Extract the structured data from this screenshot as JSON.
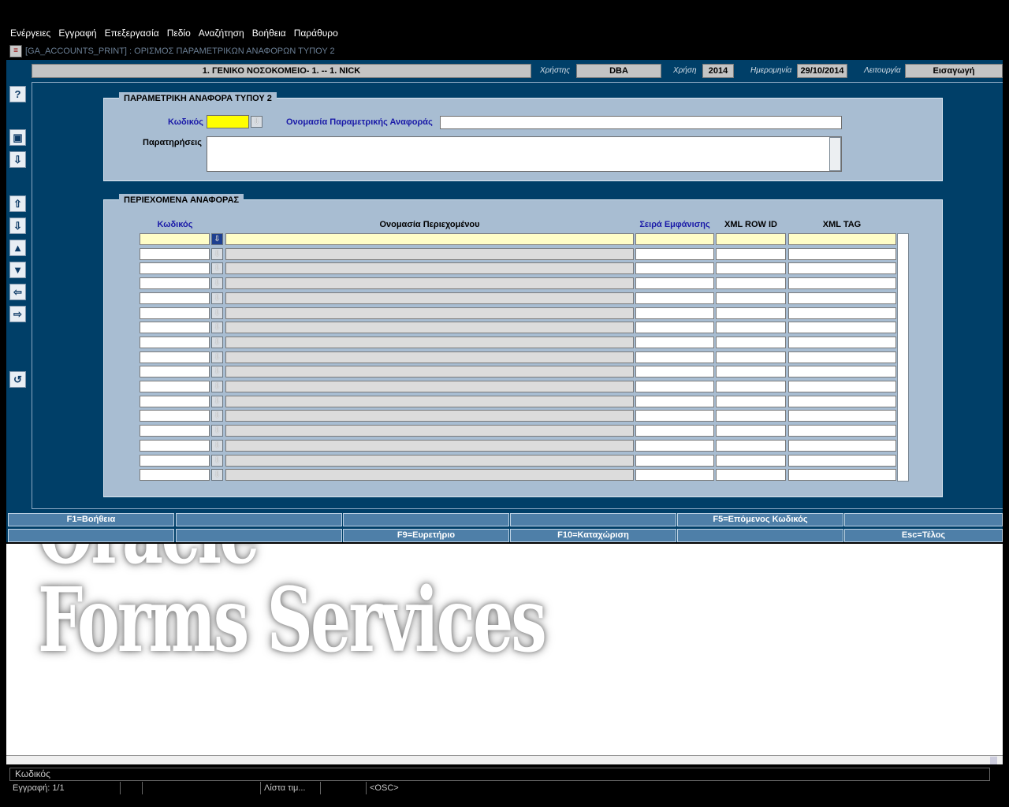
{
  "menu": [
    "Ενέργειες",
    "Εγγραφή",
    "Επεξεργασία",
    "Πεδίο",
    "Αναζήτηση",
    "Βοήθεια",
    "Παράθυρο"
  ],
  "window": {
    "title": "[GA_ACCOUNTS_PRINT]   :   ΟΡΙΣΜΟΣ ΠΑΡΑΜΕΤΡΙΚΩΝ ΑΝΑΦΟΡΩΝ ΤΥΠΟΥ 2"
  },
  "header": {
    "organization": "1. ΓΕΝΙΚΟ ΝΟΣΟΚΟΜΕΙΟ- 1. -- 1. NICK",
    "user_label": "Χρήστης",
    "user": "DBA",
    "year_label": "Χρήση",
    "year": "2014",
    "date_label": "Ημερομηνία",
    "date": "29/10/2014",
    "mode_label": "Λειτουργία",
    "mode": "Εισαγωγή"
  },
  "side_buttons": {
    "help": "?",
    "save": "▣",
    "download": "⇩",
    "first": "⇧",
    "last": "⇩",
    "prev": "▲",
    "next": "▼",
    "left": "⇦",
    "right": "⇨",
    "undo": "↺"
  },
  "report_block": {
    "title": "ΠΑΡΑΜΕΤΡΙΚΗ ΑΝΑΦΟΡΑ ΤΥΠΟΥ 2",
    "code_label": "Κωδικός",
    "code_value": "",
    "name_label": "Ονομασία Παραμετρικής Αναφοράς",
    "name_value": "",
    "notes_label": "Παρατηρήσεις",
    "notes_value": ""
  },
  "contents_block": {
    "title": "ΠΕΡΙΕΧΟΜΕΝΑ ΑΝΑΦΟΡΑΣ",
    "columns": {
      "code": "Κωδικός",
      "name": "Ονομασία Περιεχομένου",
      "order": "Σειρά Εμφάνισης",
      "rowid": "XML ROW ID",
      "tag": "XML TAG"
    },
    "row_count": 17
  },
  "function_keys": {
    "row1": [
      "F1=Βοήθεια",
      "",
      "",
      "",
      "F5=Επόμενος Κωδικός",
      ""
    ],
    "row2": [
      "",
      "",
      "F9=Ευρετήριο",
      "F10=Καταχώριση",
      "",
      "Esc=Τέλος"
    ]
  },
  "watermark": {
    "line1": "Oracle",
    "line2": "Forms Services"
  },
  "status": {
    "message": "Κωδικός",
    "record": "Εγγραφή: 1/1",
    "lov": "Λίστα τιμ...",
    "osc": "<OSC>"
  }
}
